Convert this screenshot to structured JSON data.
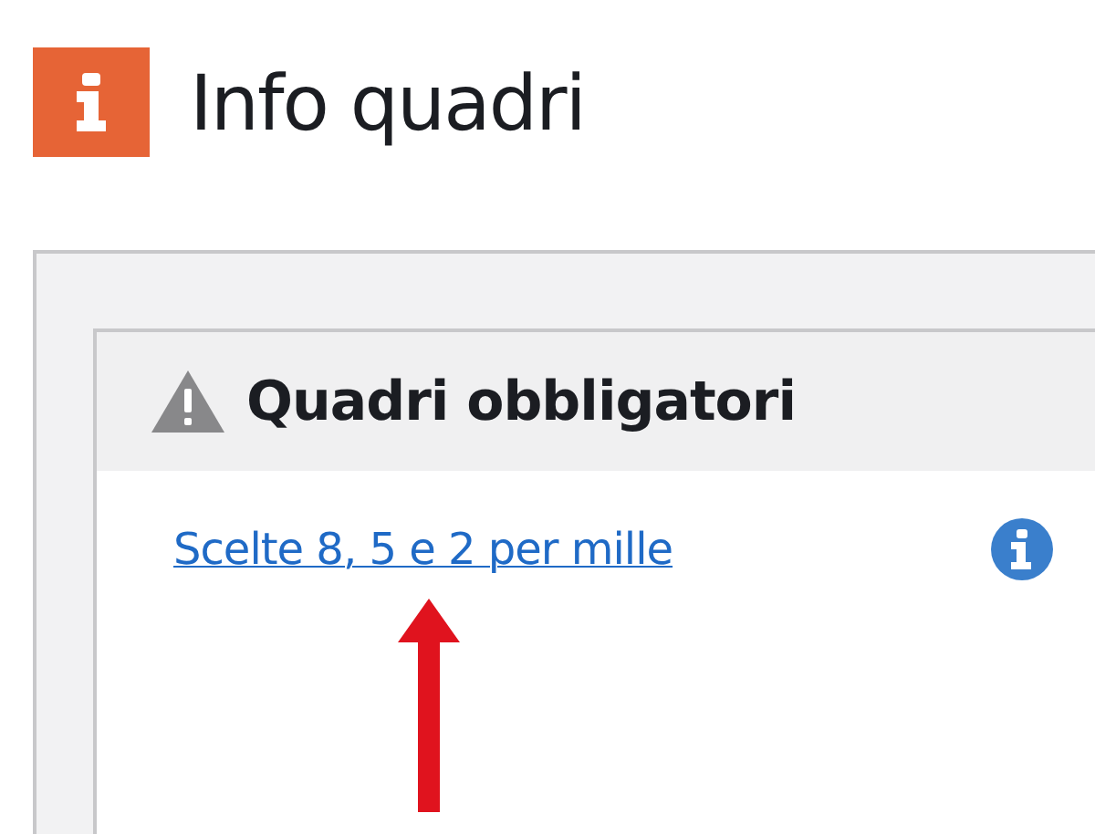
{
  "page": {
    "title": "Info quadri"
  },
  "section": {
    "title": "Quadri obbligatori",
    "links": [
      {
        "label": "Scelte 8, 5 e 2 per mille"
      }
    ]
  }
}
